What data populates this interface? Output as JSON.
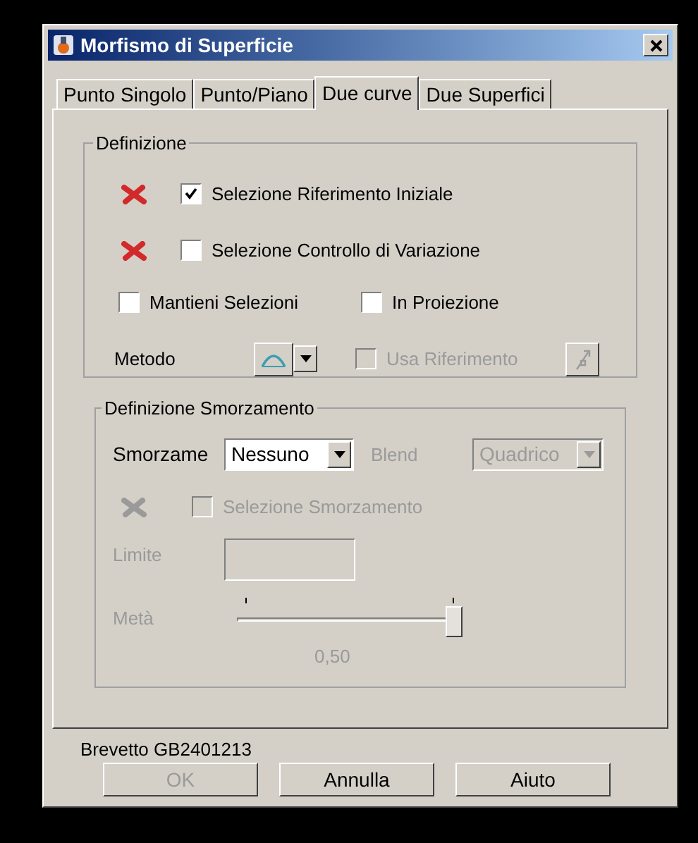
{
  "window": {
    "title": "Morfismo di Superficie"
  },
  "tabs": [
    {
      "label": "Punto Singolo",
      "selected": false
    },
    {
      "label": "Punto/Piano",
      "selected": false
    },
    {
      "label": "Due curve",
      "selected": true
    },
    {
      "label": "Due Superfici",
      "selected": false
    }
  ],
  "definition": {
    "title": "Definizione",
    "selections": [
      {
        "label": "Selezione Riferimento Iniziale",
        "checked": true,
        "disabled": false
      },
      {
        "label": "Selezione Controllo di Variazione",
        "checked": false,
        "disabled": false
      }
    ],
    "options": [
      {
        "label": "Mantieni Selezioni",
        "checked": false
      },
      {
        "label": "In Proiezione",
        "checked": false
      }
    ],
    "method_label": "Metodo",
    "use_reference": {
      "label": "Usa Riferimento",
      "checked": false,
      "disabled": true
    }
  },
  "damping": {
    "title": "Definizione Smorzamento",
    "damping_label": "Smorzame",
    "damping_value": "Nessuno",
    "blend_label": "Blend",
    "blend_value": "Quadrico",
    "blend_disabled": true,
    "selection": {
      "label": "Selezione Smorzamento",
      "checked": false,
      "disabled": true
    },
    "limit_label": "Limite",
    "half_label": "Metà",
    "level": 1,
    "half_reading": "0,50"
  },
  "patent": "Brevetto GB2401213",
  "buttons": [
    {
      "label": "OK",
      "disabled": true
    },
    {
      "label": "Annulla",
      "disabled": false
    },
    {
      "label": "Aiuto",
      "disabled": false
    }
  ]
}
